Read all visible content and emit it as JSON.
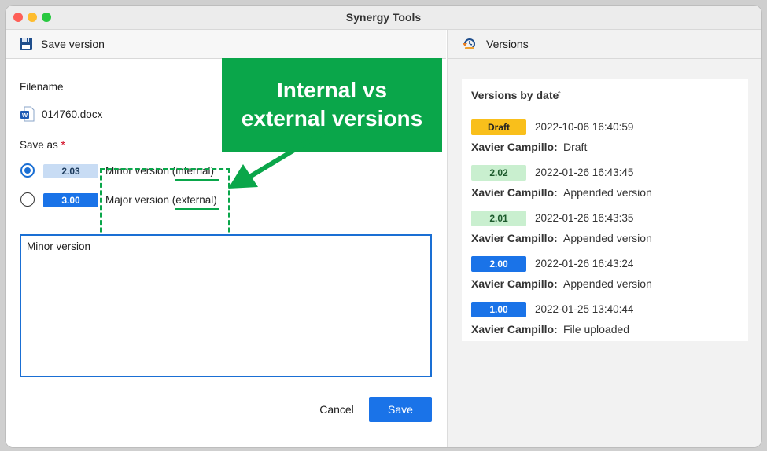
{
  "window": {
    "title": "Synergy Tools"
  },
  "left_pane": {
    "header": "Save version",
    "filename_label": "Filename",
    "filename": "014760.docx",
    "save_as_label": "Save as",
    "required_marker": "*",
    "options": [
      {
        "badge": "2.03",
        "text_prefix": "Minor version ",
        "text_kind": "(internal)",
        "selected": true
      },
      {
        "badge": "3.00",
        "text_prefix": "Major version ",
        "text_kind": "(external)",
        "selected": false
      }
    ],
    "comment_value": "Minor version",
    "cancel_label": "Cancel",
    "save_label": "Save"
  },
  "annotation": {
    "line1": "Internal vs",
    "line2": "external versions",
    "color": "#0aa64a"
  },
  "right_pane": {
    "header": "Versions",
    "card_title": "Versions by date",
    "sort_icon": "↑",
    "entries": [
      {
        "badge": "Draft",
        "kind": "draft",
        "date": "2022-10-06 16:40:59",
        "user": "Xavier Campillo",
        "note": "Draft"
      },
      {
        "badge": "2.02",
        "kind": "minor",
        "date": "2022-01-26 16:43:45",
        "user": "Xavier Campillo",
        "note": "Appended version"
      },
      {
        "badge": "2.01",
        "kind": "minor",
        "date": "2022-01-26 16:43:35",
        "user": "Xavier Campillo",
        "note": "Appended version"
      },
      {
        "badge": "2.00",
        "kind": "major",
        "date": "2022-01-26 16:43:24",
        "user": "Xavier Campillo",
        "note": "Appended version"
      },
      {
        "badge": "1.00",
        "kind": "major",
        "date": "2022-01-25 13:40:44",
        "user": "Xavier Campillo",
        "note": "File uploaded"
      }
    ]
  },
  "colors": {
    "accent": "#1a73e8",
    "draft": "#f9bf1b",
    "minor_badge": "#c9efcf",
    "annotation": "#0aa64a"
  }
}
